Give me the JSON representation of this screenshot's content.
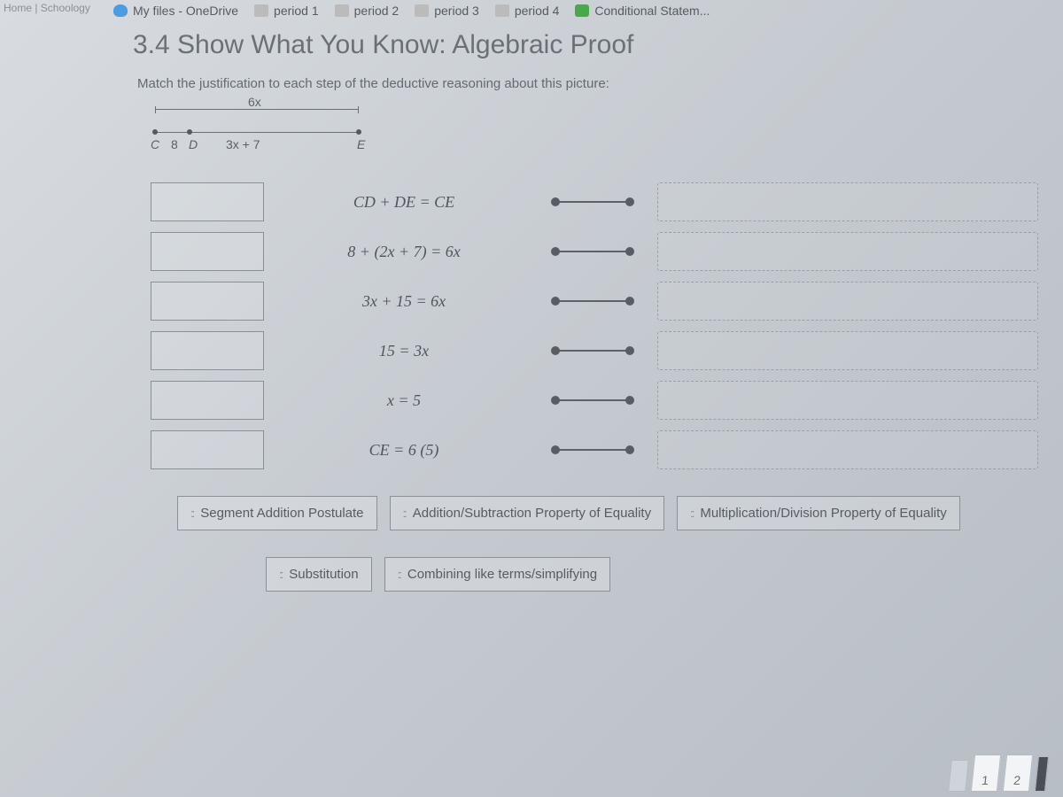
{
  "edges": {
    "left_partial": "Home | Schoology",
    "right_partial": ""
  },
  "bookmarks": {
    "items": [
      {
        "label": "My files - OneDrive",
        "icon": "cloud"
      },
      {
        "label": "period 1",
        "icon": "folder"
      },
      {
        "label": "period 2",
        "icon": "folder"
      },
      {
        "label": "period 3",
        "icon": "folder"
      },
      {
        "label": "period 4",
        "icon": "folder"
      },
      {
        "label": "Conditional Statem...",
        "icon": "check"
      }
    ]
  },
  "title": "3.4 Show What You Know: Algebraic Proof",
  "instructions": "Match the justification to each step of the deductive reasoning about this picture:",
  "figure": {
    "top_label": "6x",
    "pt_c": "C",
    "seg_cd": "8",
    "pt_d": "D",
    "seg_de": "3x + 7",
    "pt_e": "E"
  },
  "steps": [
    {
      "eqn": "CD + DE = CE"
    },
    {
      "eqn": "8 + (2x + 7) = 6x"
    },
    {
      "eqn": "3x + 15 = 6x"
    },
    {
      "eqn": "15 = 3x"
    },
    {
      "eqn": "x = 5"
    },
    {
      "eqn": "CE = 6 (5)"
    }
  ],
  "bank": {
    "row1": [
      "Segment Addition Postulate",
      "Addition/Subtraction Property of Equality",
      "Multiplication/Division Property of Equality"
    ],
    "row2": [
      "Substitution",
      "Combining like terms/simplifying"
    ]
  },
  "pageflip": {
    "a": "1",
    "b": "2"
  }
}
